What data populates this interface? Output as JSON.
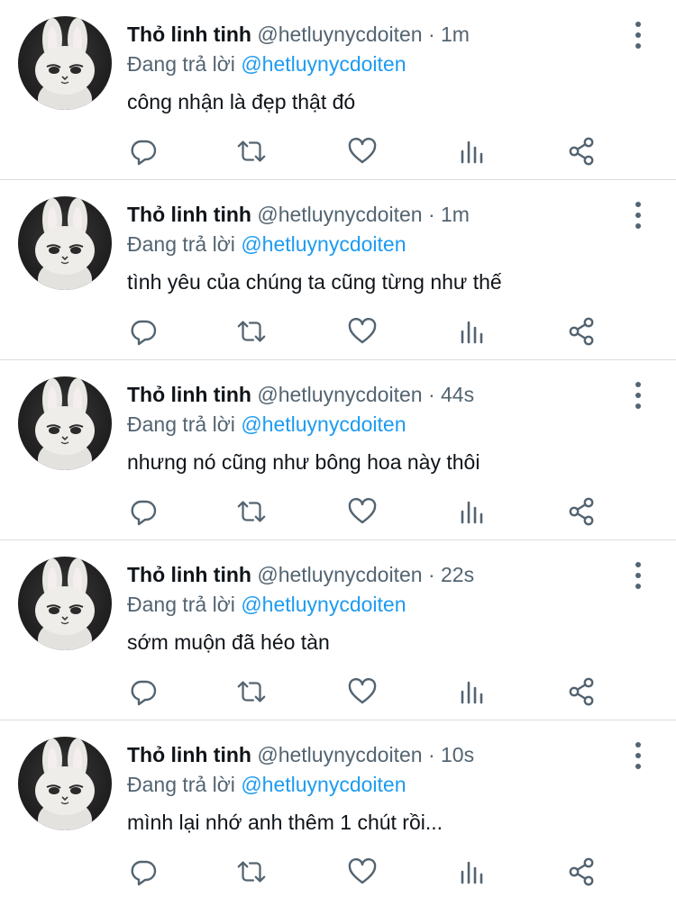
{
  "reply_prefix": "Đang trả lời",
  "icons": {
    "reply": "reply-icon",
    "retweet": "retweet-icon",
    "like": "like-icon",
    "views": "views-icon",
    "share": "share-icon",
    "more": "more-icon"
  },
  "colors": {
    "link": "#1d9bf0",
    "secondary": "#536471",
    "text": "#0f1419",
    "divider": "#d9dde0"
  },
  "tweets": [
    {
      "name": "Thỏ linh tinh",
      "handle": "@hetluynycdoiten",
      "separator": "·",
      "time": "1m",
      "reply_to": "@hetluynycdoiten",
      "text": "công nhận là đẹp thật đó"
    },
    {
      "name": "Thỏ linh tinh",
      "handle": "@hetluynycdoiten",
      "separator": "·",
      "time": "1m",
      "reply_to": "@hetluynycdoiten",
      "text": "tình yêu của chúng ta cũng từng như thế"
    },
    {
      "name": "Thỏ linh tinh",
      "handle": "@hetluynycdoiten",
      "separator": "·",
      "time": "44s",
      "reply_to": "@hetluynycdoiten",
      "text": "nhưng nó cũng như bông hoa này thôi"
    },
    {
      "name": "Thỏ linh tinh",
      "handle": "@hetluynycdoiten",
      "separator": "·",
      "time": "22s",
      "reply_to": "@hetluynycdoiten",
      "text": "sớm muộn đã héo tàn"
    },
    {
      "name": "Thỏ linh tinh",
      "handle": "@hetluynycdoiten",
      "separator": "·",
      "time": "10s",
      "reply_to": "@hetluynycdoiten",
      "text": "mình lại nhớ anh thêm 1 chút rồi..."
    }
  ]
}
